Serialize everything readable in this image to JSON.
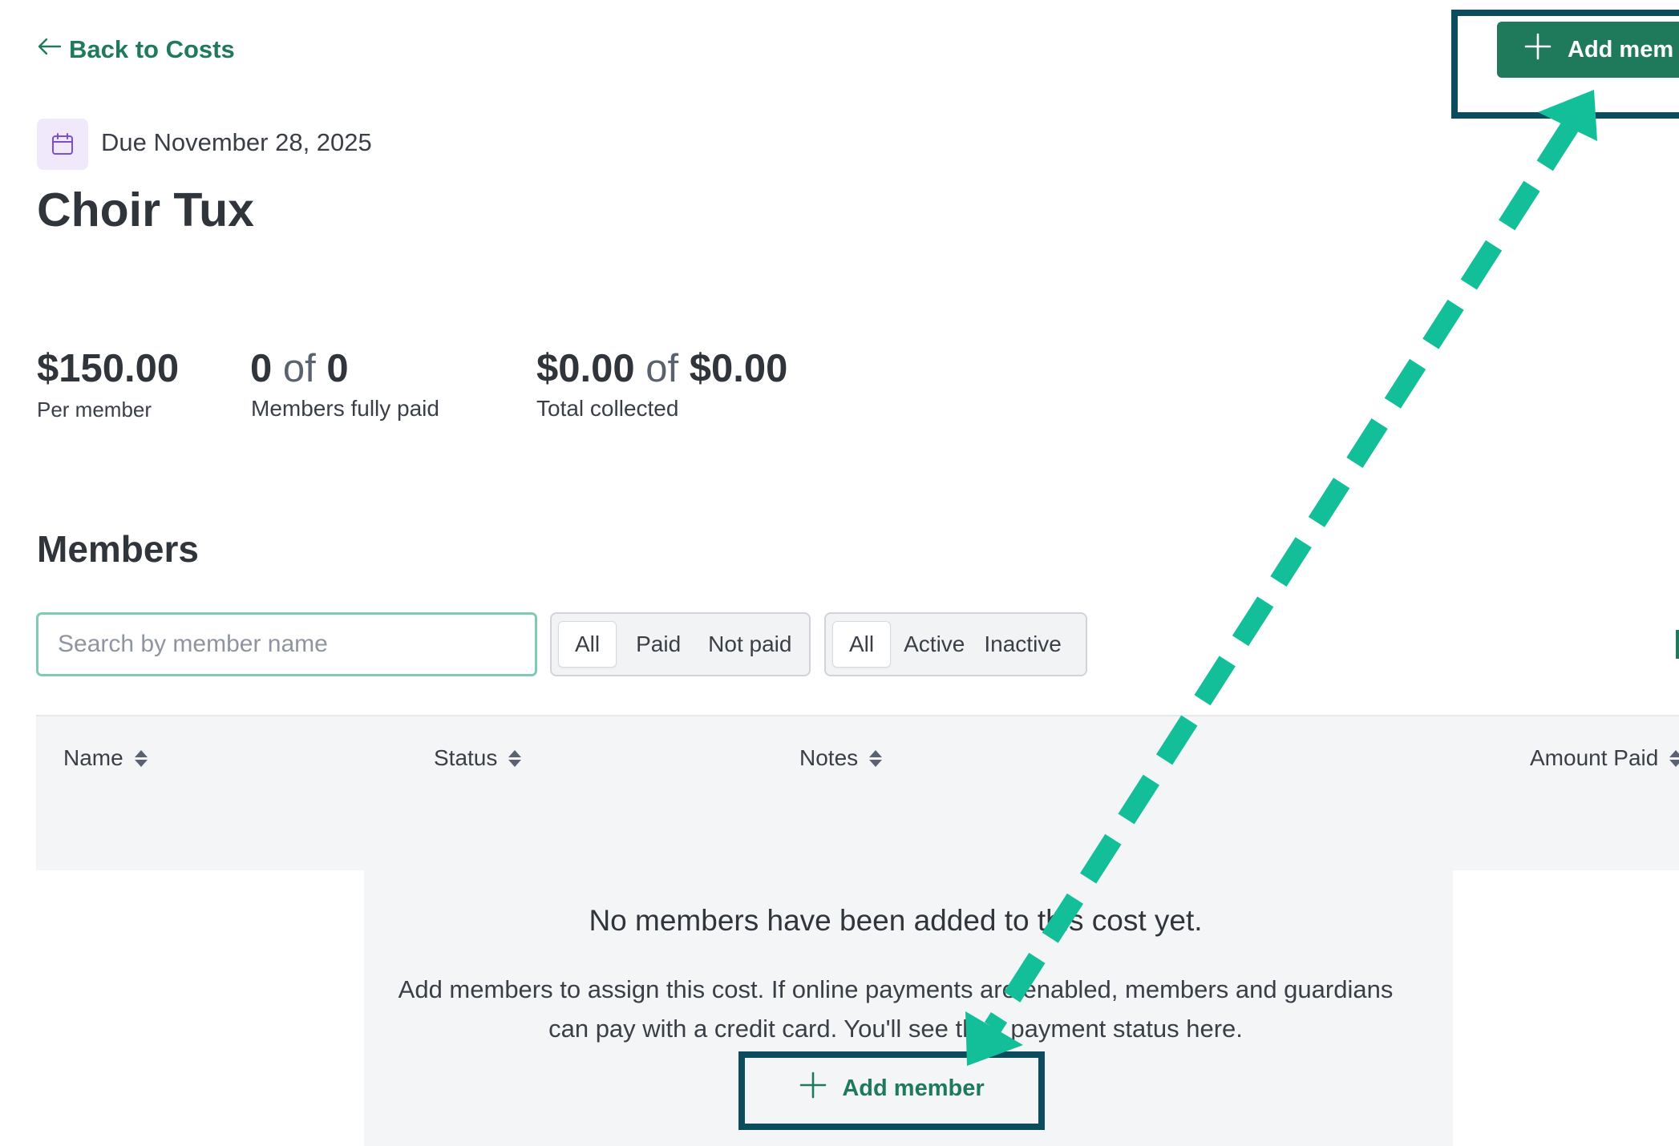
{
  "nav": {
    "back_label": "Back to Costs"
  },
  "header": {
    "add_button_label": "Add mem",
    "due_label": "Due November 28, 2025",
    "title": "Choir Tux"
  },
  "stats": {
    "per_member": {
      "value": "$150.00",
      "label": "Per member"
    },
    "members_paid": {
      "count": "0",
      "of": "of",
      "total": "0",
      "label": "Members fully paid"
    },
    "collected": {
      "amount": "$0.00",
      "of": "of",
      "total": "$0.00",
      "label": "Total collected"
    }
  },
  "members": {
    "heading": "Members",
    "search_placeholder": "Search by member name",
    "payment_filter": [
      "All",
      "Paid",
      "Not paid"
    ],
    "active_filter": [
      "All",
      "Active",
      "Inactive"
    ],
    "columns": [
      "Name",
      "Status",
      "Notes",
      "Amount Paid"
    ],
    "empty": {
      "title": "No members have been added to this cost yet.",
      "line1": "Add members to assign this cost. If online payments are enabled, members and guardians",
      "line2": "can pay with a credit card. You'll see their payment status here.",
      "button_label": "Add member"
    }
  },
  "colors": {
    "brand_green": "#1f7a5c",
    "annotation_arrow": "#13bf98",
    "annotation_box": "#0d4b5e"
  }
}
